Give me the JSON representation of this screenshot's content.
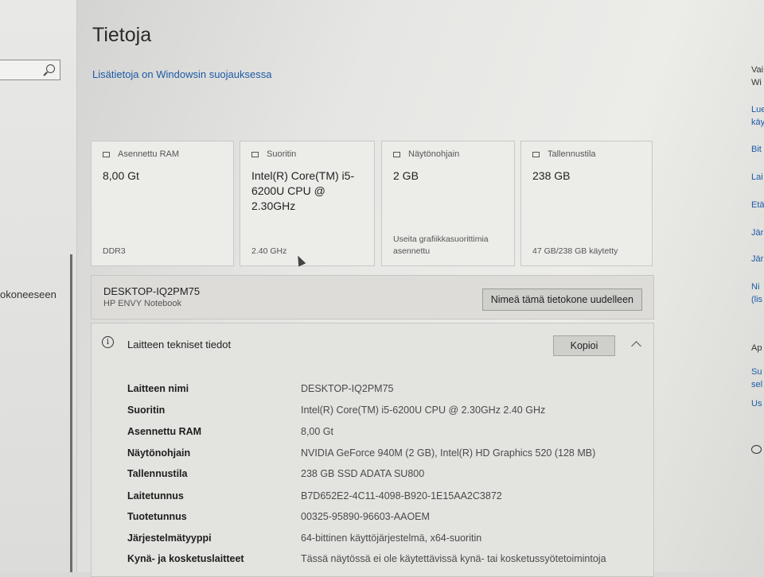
{
  "page": {
    "title": "Tietoja",
    "security_link": "Lisätietoja on Windowsin suojauksessa"
  },
  "left": {
    "partial_text": "okoneeseen"
  },
  "cards": [
    {
      "icon": "ram-icon",
      "header": "Asennettu RAM",
      "value": "8,00 Gt",
      "footer": "DDR3"
    },
    {
      "icon": "processor-icon",
      "header": "Suoritin",
      "value": "Intel(R) Core(TM) i5-6200U CPU @ 2.30GHz",
      "footer": "2.40 GHz"
    },
    {
      "icon": "display-adapter-icon",
      "header": "Näytönohjain",
      "value": "2 GB",
      "footer": "Useita grafiikkasuorittimia asennettu"
    },
    {
      "icon": "storage-icon",
      "header": "Tallennustila",
      "value": "238 GB",
      "footer": "47 GB/238 GB käytetty"
    }
  ],
  "device": {
    "name": "DESKTOP-IQ2PM75",
    "model": "HP ENVY Notebook",
    "rename_label": "Nimeä tämä tietokone uudelleen"
  },
  "specs": {
    "title": "Laitteen tekniset tiedot",
    "copy_label": "Kopioi",
    "rows": [
      {
        "label": "Laitteen nimi",
        "value": "DESKTOP-IQ2PM75"
      },
      {
        "label": "Suoritin",
        "value": "Intel(R) Core(TM) i5-6200U CPU @ 2.30GHz   2.40 GHz"
      },
      {
        "label": "Asennettu RAM",
        "value": "8,00 Gt"
      },
      {
        "label": "Näytönohjain",
        "value": "NVIDIA GeForce 940M (2 GB), Intel(R) HD Graphics 520 (128 MB)"
      },
      {
        "label": "Tallennustila",
        "value": "238 GB SSD ADATA SU800"
      },
      {
        "label": "Laitetunnus",
        "value": "B7D652E2-4C11-4098-B920-1E15AA2C3872"
      },
      {
        "label": "Tuotetunnus",
        "value": "00325-95890-96603-AAOEM"
      },
      {
        "label": "Järjestelmätyyppi",
        "value": "64-bittinen käyttöjärjestelmä, x64-suoritin"
      },
      {
        "label": "Kynä- ja kosketuslaitteet",
        "value": "Tässä näytössä ei ole käytettävissä kynä- tai kosketussyötetoimintoja"
      }
    ]
  },
  "right_strip": [
    {
      "text": "Vai",
      "link": false
    },
    {
      "text": "Wi",
      "link": false
    },
    {
      "text": "Lue",
      "link": true
    },
    {
      "text": "käy",
      "link": true
    },
    {
      "text": "Bit",
      "link": true
    },
    {
      "text": "Lai",
      "link": true
    },
    {
      "text": "Etä",
      "link": true
    },
    {
      "text": "Jär",
      "link": true
    },
    {
      "text": "Jär",
      "link": true
    },
    {
      "text": "Ni",
      "link": true
    },
    {
      "text": "(lis",
      "link": true
    },
    {
      "text": "Ap",
      "link": false
    },
    {
      "text": "Su",
      "link": true
    },
    {
      "text": "sel",
      "link": true
    },
    {
      "text": "Us",
      "link": true
    }
  ]
}
